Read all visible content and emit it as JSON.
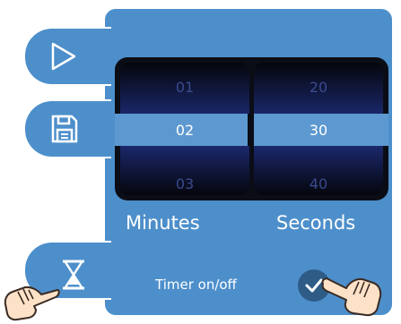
{
  "sidebar": {
    "tabs": [
      {
        "icon": "play-icon"
      },
      {
        "icon": "save-icon"
      },
      {
        "icon": "hourglass-icon"
      }
    ]
  },
  "picker": {
    "minutes": {
      "above": "01",
      "selected": "02",
      "below": "03",
      "label": "Minutes"
    },
    "seconds": {
      "above": "20",
      "selected": "30",
      "below": "40",
      "label": "Seconds"
    }
  },
  "timer_toggle": {
    "label": "Timer on/off",
    "state": "on",
    "icon": "checkmark-icon"
  },
  "colors": {
    "panel": "#4d8fcb",
    "border": "#ffffff",
    "picker_bg": "#0b0d16",
    "selection_band": "#5d99d0",
    "toggle": "#2e5c87"
  }
}
